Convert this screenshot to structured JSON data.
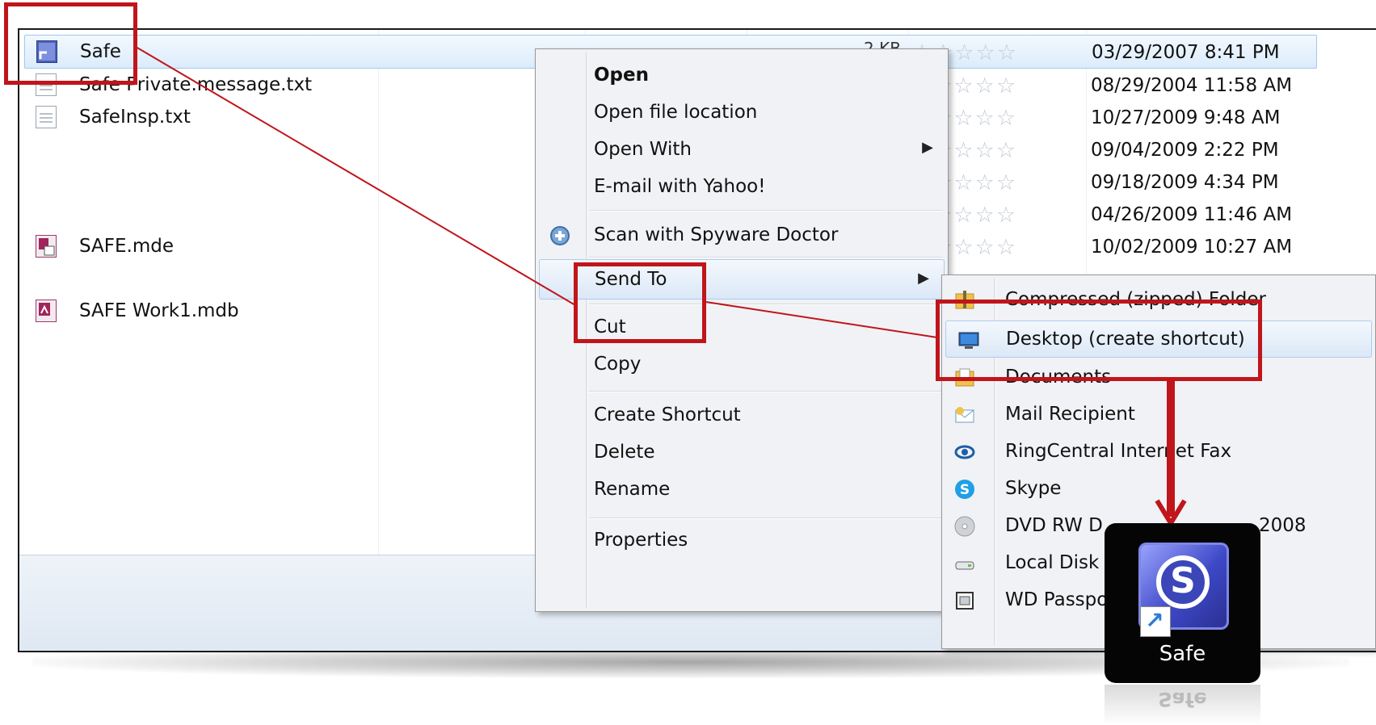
{
  "files": [
    {
      "name": "Safe",
      "size": "2 KB",
      "date": "03/29/2007 8:41 PM",
      "icon": "shortcut-app-icon",
      "selected": true
    },
    {
      "name": "Safe Private.message.txt",
      "date": "08/29/2004 11:58 AM",
      "icon": "text-file-icon"
    },
    {
      "name": "SafeInsp.txt",
      "date": "10/27/2009 9:48 AM",
      "icon": "text-file-icon"
    },
    {
      "name": "",
      "date": "09/04/2009 2:22 PM"
    },
    {
      "name": "",
      "date": "09/18/2009 4:34 PM"
    },
    {
      "name": "",
      "date": "04/26/2009 11:46 AM"
    },
    {
      "name": "SAFE.mde",
      "date": "10/02/2009 10:27 AM",
      "icon": "access-mde-icon"
    },
    {
      "name": "SAFE Work1.mdb",
      "icon": "access-mdb-icon"
    }
  ],
  "rating_stars": "☆☆☆☆☆",
  "context_menu": {
    "open": "Open",
    "open_file_location": "Open file location",
    "open_with": "Open With",
    "email_yahoo": "E-mail with Yahoo!",
    "scan_spyware": "Scan with Spyware Doctor",
    "send_to": "Send To",
    "cut": "Cut",
    "copy": "Copy",
    "create_shortcut": "Create Shortcut",
    "delete": "Delete",
    "rename": "Rename",
    "properties": "Properties",
    "submenu_arrow": "▶"
  },
  "send_to_menu": {
    "compressed_folder": "Compressed (zipped) Folder",
    "desktop_shortcut": "Desktop (create shortcut)",
    "documents": "Documents",
    "mail_recipient": "Mail Recipient",
    "ringcentral_fax": "RingCentral Internet Fax",
    "skype": "Skype",
    "dvd_rw": "DVD RW D",
    "dvd_rw_suffix": "2008",
    "local_disk": "Local Disk",
    "wd_passport": "WD Passpo"
  },
  "desktop_icon": {
    "label": "Safe",
    "letter": "S",
    "reflection": "Safe"
  },
  "annotation_color": "#c0151b"
}
